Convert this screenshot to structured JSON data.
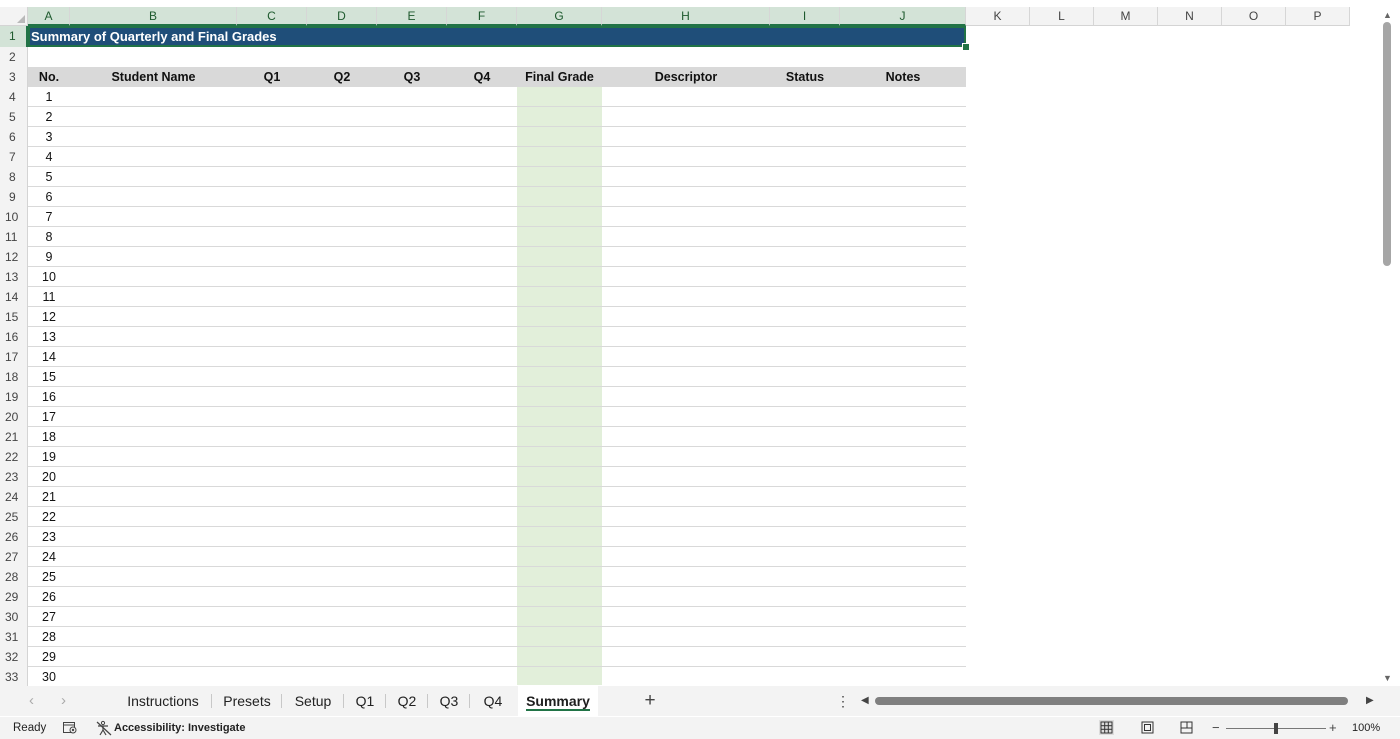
{
  "columns": [
    "A",
    "B",
    "C",
    "D",
    "E",
    "F",
    "G",
    "H",
    "I",
    "J",
    "K",
    "L",
    "M",
    "N",
    "O",
    "P"
  ],
  "selected_row": "1",
  "selected_columns": [
    "A",
    "B",
    "C",
    "D",
    "E",
    "F",
    "G",
    "H",
    "I",
    "J"
  ],
  "row_numbers": [
    "1",
    "2",
    "3",
    "4",
    "5",
    "6",
    "7",
    "8",
    "9",
    "10",
    "11",
    "12",
    "13",
    "14",
    "15",
    "16",
    "17",
    "18",
    "19",
    "20",
    "21",
    "22",
    "23",
    "24",
    "25",
    "26",
    "27",
    "28",
    "29",
    "30",
    "31",
    "32",
    "33"
  ],
  "sheet": {
    "title": "Summary of Quarterly and Final Grades",
    "headers": {
      "no": "No.",
      "student_name": "Student Name",
      "q1": "Q1",
      "q2": "Q2",
      "q3": "Q3",
      "q4": "Q4",
      "final_grade": "Final Grade",
      "descriptor": "Descriptor",
      "status": "Status",
      "notes": "Notes"
    },
    "student_numbers": [
      "1",
      "2",
      "3",
      "4",
      "5",
      "6",
      "7",
      "8",
      "9",
      "10",
      "11",
      "12",
      "13",
      "14",
      "15",
      "16",
      "17",
      "18",
      "19",
      "20",
      "21",
      "22",
      "23",
      "24",
      "25",
      "26",
      "27",
      "28",
      "29",
      "30"
    ],
    "final_grade_fill": "#e2efda",
    "title_fill": "#1f4e79",
    "header_fill": "#d9d9d9"
  },
  "sheet_tabs": [
    "Instructions",
    "Presets",
    "Setup",
    "Q1",
    "Q2",
    "Q3",
    "Q4",
    "Summary"
  ],
  "active_tab": "Summary",
  "status_bar": {
    "ready": "Ready",
    "accessibility": "Accessibility: Investigate",
    "zoom": "100%"
  },
  "icons": {
    "prev_sheet": "chevron-left-icon",
    "next_sheet": "chevron-right-icon",
    "add_sheet": "plus-icon",
    "more": "more-dots-icon",
    "macro": "macro-record-icon",
    "accessibility": "accessibility-icon",
    "normal_view": "normal-view-icon",
    "page_layout": "page-layout-icon",
    "page_break": "page-break-preview-icon"
  },
  "accent_color": "#217346"
}
